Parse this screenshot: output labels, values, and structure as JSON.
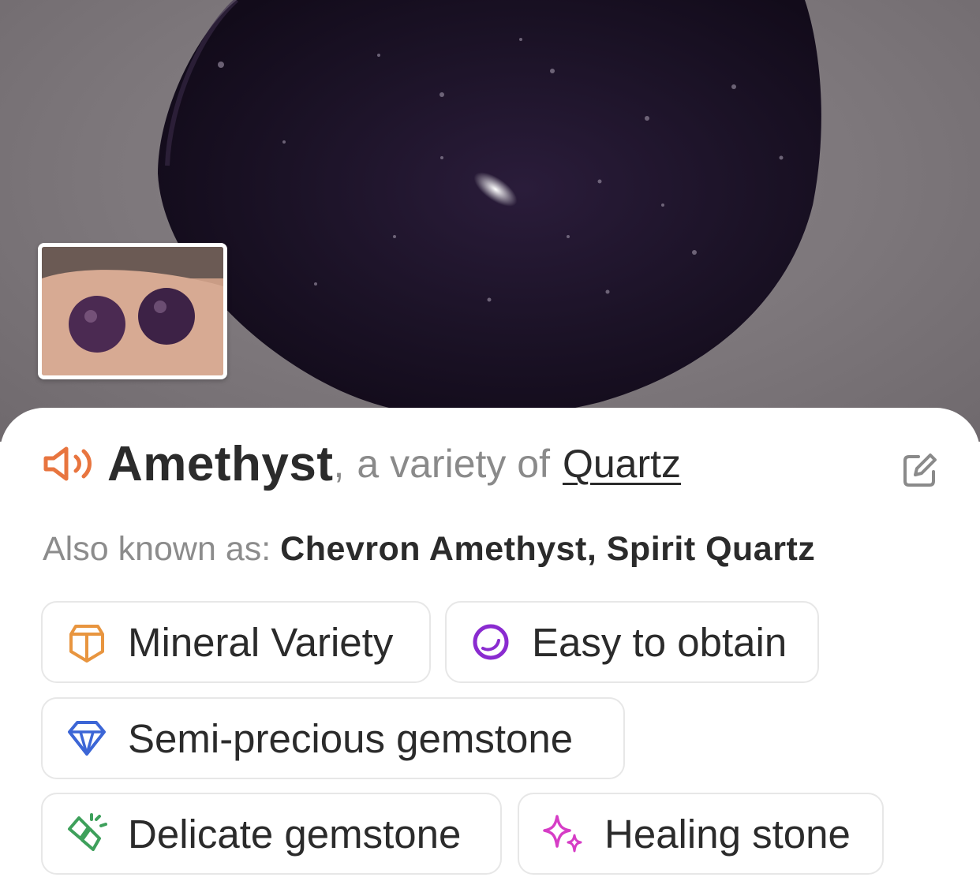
{
  "header": {
    "name": "Amethyst",
    "separator": ",",
    "variety_prefix": "a variety of",
    "parent": "Quartz"
  },
  "aka": {
    "label": "Also known as:",
    "value": "Chevron Amethyst, Spirit Quartz"
  },
  "tags": [
    {
      "label": "Mineral Variety",
      "icon": "crystal-icon",
      "color": "#E8953F"
    },
    {
      "label": "Easy to obtain",
      "icon": "circle-icon",
      "color": "#8A2BD0"
    },
    {
      "label": "Semi-precious gemstone",
      "icon": "diamond-icon",
      "color": "#3C66D6"
    },
    {
      "label": "Delicate gemstone",
      "icon": "broken-gem-icon",
      "color": "#3EA05B"
    },
    {
      "label": "Healing stone",
      "icon": "sparkle-icon",
      "color": "#D63DC6"
    }
  ],
  "colors": {
    "speaker": "#E8753F",
    "text": "#2B2B2B",
    "muted": "#8A8A8A"
  }
}
